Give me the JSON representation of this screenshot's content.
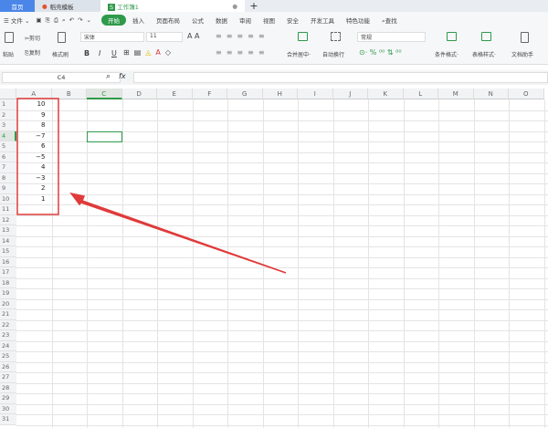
{
  "tabs": {
    "home": "首页",
    "template": "稻壳模板",
    "doc": "工作簿1",
    "doc_icon": "S"
  },
  "menu": {
    "file": "文件",
    "items": [
      "开始",
      "插入",
      "页面布局",
      "公式",
      "数据",
      "审阅",
      "视图",
      "安全",
      "开发工具",
      "特色功能"
    ],
    "search": "查找"
  },
  "ribbon": {
    "paste": "粘贴",
    "cut": "剪切",
    "copy": "复制",
    "format_painter": "格式刷",
    "font": "宋体",
    "size": "11",
    "bold": "B",
    "italic": "I",
    "underline": "U",
    "merge": "合并居中",
    "wrap": "自动换行",
    "number_format": "常规",
    "percent": "%",
    "cond_format": "条件格式",
    "table_style": "表格样式",
    "doc_assist": "文档助手"
  },
  "formula": {
    "name_box": "C4",
    "fx": "fx"
  },
  "columns": [
    "A",
    "B",
    "C",
    "D",
    "E",
    "F",
    "G",
    "H",
    "I",
    "J",
    "K",
    "L",
    "M",
    "N",
    "O"
  ],
  "values": [
    "10",
    "9",
    "8",
    "−7",
    "6",
    "−5",
    "4",
    "−3",
    "2",
    "1"
  ],
  "selected_cell": "C4",
  "colors": {
    "accent": "#2e9a4a",
    "annotation": "#e03a3a"
  }
}
